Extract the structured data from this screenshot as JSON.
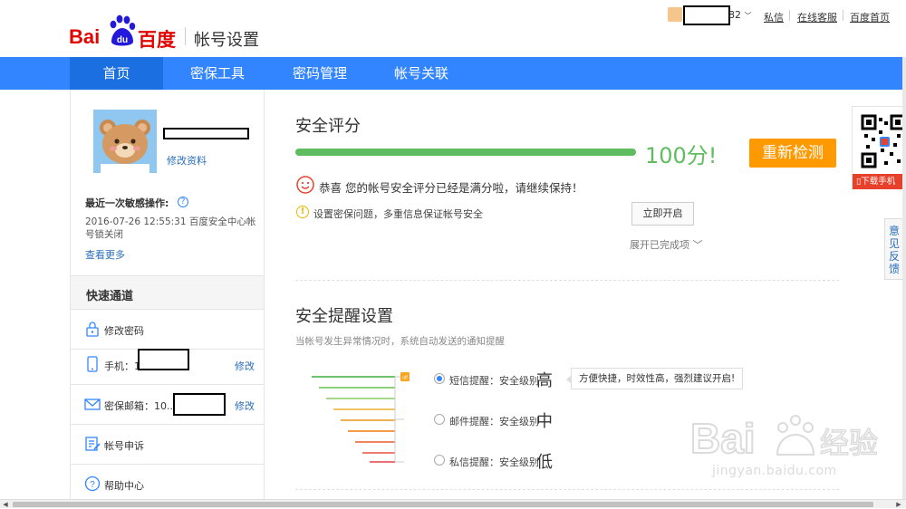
{
  "header": {
    "logo_text_bai": "Bai",
    "logo_text_du": "du",
    "logo_text_cn": "百度",
    "page_name": "帐号设置",
    "username_tail": "82",
    "links": [
      "私信",
      "在线客服",
      "百度首页"
    ]
  },
  "nav": {
    "items": [
      {
        "label": "首页",
        "active": true
      },
      {
        "label": "密保工具",
        "active": false
      },
      {
        "label": "密码管理",
        "active": false
      },
      {
        "label": "帐号关联",
        "active": false
      }
    ]
  },
  "sidebar": {
    "edit_profile": "修改资料",
    "recent_label": "最近一次敏感操作:",
    "recent_text": "2016-07-26 12:55:31  百度安全中心帐号锁关闭",
    "recent_more": "查看更多",
    "quick_title": "快速通道",
    "quick_items": [
      {
        "label": "修改密码",
        "icon": "lock-icon",
        "edit": ""
      },
      {
        "label": "手机：1",
        "icon": "phone-icon",
        "edit": "修改"
      },
      {
        "label": "密保邮箱：10...2",
        "icon": "mail-icon",
        "edit": "修改"
      },
      {
        "label": "帐号申诉",
        "icon": "appeal-icon",
        "edit": ""
      },
      {
        "label": "帮助中心",
        "icon": "help-icon",
        "edit": ""
      }
    ]
  },
  "score": {
    "title": "安全评分",
    "value_text": "100分!",
    "progress": 1.0,
    "recheck_label": "重新检测",
    "congrats": "恭喜 您的帐号安全评分已经是满分啦，请继续保持！",
    "tip": "设置密保问题，多重信息保证帐号安全",
    "open_label": "立即开启",
    "expand_label": "展开已完成项 ﹀"
  },
  "alerts": {
    "title": "安全提醒设置",
    "subtitle": "当帐号发生异常情况时，系统自动发送的通知提醒",
    "options": [
      {
        "label": "短信提醒：安全级别",
        "level": "高",
        "selected": true
      },
      {
        "label": "邮件提醒：安全级别",
        "level": "中",
        "selected": false
      },
      {
        "label": "私信提醒：安全级别",
        "level": "低",
        "selected": false
      }
    ],
    "tooltip": "方便快捷，时效性高，强烈建议开启!",
    "marker": "off"
  },
  "widgets": {
    "qr_download": "下载手机",
    "feedback": "意见反馈"
  },
  "watermark": {
    "text": "jingyan.baidu.com"
  },
  "colors": {
    "nav_blue": "#3385ff",
    "score_green": "#5fbd5f",
    "recheck_orange": "#ff9900",
    "brand_red": "#e10602"
  }
}
